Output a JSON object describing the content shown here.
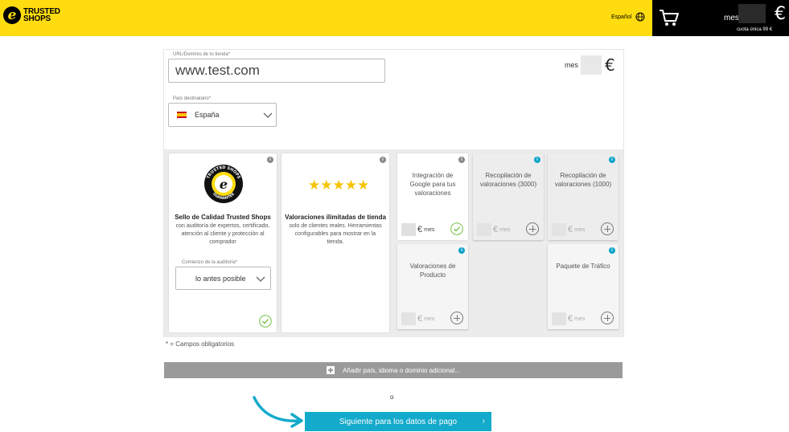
{
  "header": {
    "logo_line1": "TRUSTED",
    "logo_line2": "SHOPS",
    "language": "Español",
    "cart_price_label": "mes",
    "cart_euro": "€",
    "cart_fee": "cuota única 99 €",
    "brand_color": "#ffdc0f",
    "icons": [
      "globe-icon",
      "cart-icon",
      "logo-e-icon"
    ]
  },
  "form": {
    "url_label": "URL/Dominio de tu tienda*",
    "url_value": "www.test.com",
    "country_label": "País destinatario*",
    "country_value": "España",
    "top_price_label": "mes",
    "top_price_euro": "€"
  },
  "cards": {
    "seal": {
      "title": "Sello de Calidad Trusted Shops",
      "desc": "con auditoría de expertos, certificado, atención al cliente y protección al comprador",
      "audit_label": "Comienzo de la auditoría*",
      "audit_value": "lo antes posible",
      "seal_top": "TRUSTED SHOPS",
      "seal_bottom": "GUARANTEE"
    },
    "reviews": {
      "stars": "★★★★★",
      "title": "Valoraciones ilimitadas de tienda",
      "desc": "solo de clientes reales. Herramientas configurables para mostrar en la tienda."
    },
    "google": {
      "title": "Integración de Google para tus valoraciones",
      "euro": "€",
      "mes": "mes"
    },
    "collect3000": {
      "title": "Recopilación de valoraciones (3000)",
      "euro": "€",
      "mes": "mes"
    },
    "collect1000": {
      "title": "Recopilación de valoraciones (1000)",
      "euro": "€",
      "mes": "mes"
    },
    "product": {
      "title": "Valoraciones de Producto",
      "euro": "€",
      "mes": "mes"
    },
    "traffic": {
      "title": "Paquete de Tráfico",
      "euro": "€",
      "mes": "mes"
    },
    "accent_color": "#0aa3c9",
    "check_color": "#6fbf3f"
  },
  "footer": {
    "required_note": "* = Campos obligatorios",
    "add_label": "Añadir país, idioma o dominio adicional...",
    "or_text": "o",
    "next_label": "Siguiente para los datos de pago",
    "next_arrow": "›",
    "button_color": "#13aacb"
  }
}
